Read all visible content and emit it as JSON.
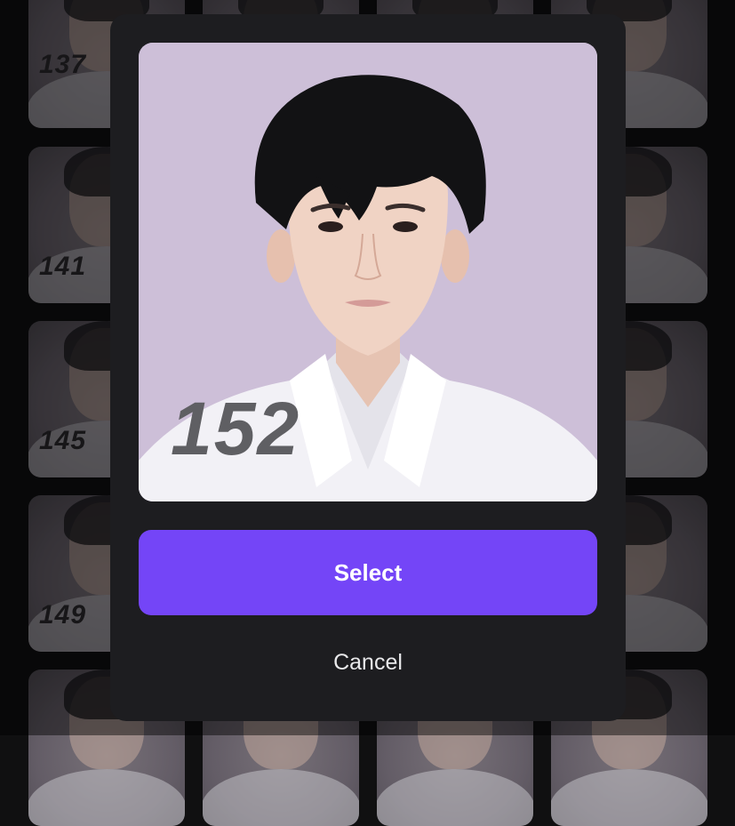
{
  "background_grid": {
    "cards": [
      {
        "number": "137"
      },
      {
        "number": ""
      },
      {
        "number": ""
      },
      {
        "number": ""
      },
      {
        "number": "141"
      },
      {
        "number": ""
      },
      {
        "number": ""
      },
      {
        "number": ""
      },
      {
        "number": "145"
      },
      {
        "number": ""
      },
      {
        "number": ""
      },
      {
        "number": ""
      },
      {
        "number": "149"
      },
      {
        "number": ""
      },
      {
        "number": ""
      },
      {
        "number": ""
      },
      {
        "number": ""
      },
      {
        "number": ""
      },
      {
        "number": ""
      },
      {
        "number": ""
      }
    ]
  },
  "modal": {
    "photo_number": "152",
    "select_label": "Select",
    "cancel_label": "Cancel"
  },
  "colors": {
    "accent": "#7445f7",
    "modal_bg": "#1d1d20",
    "photo_bg": "#cdbfd8"
  }
}
